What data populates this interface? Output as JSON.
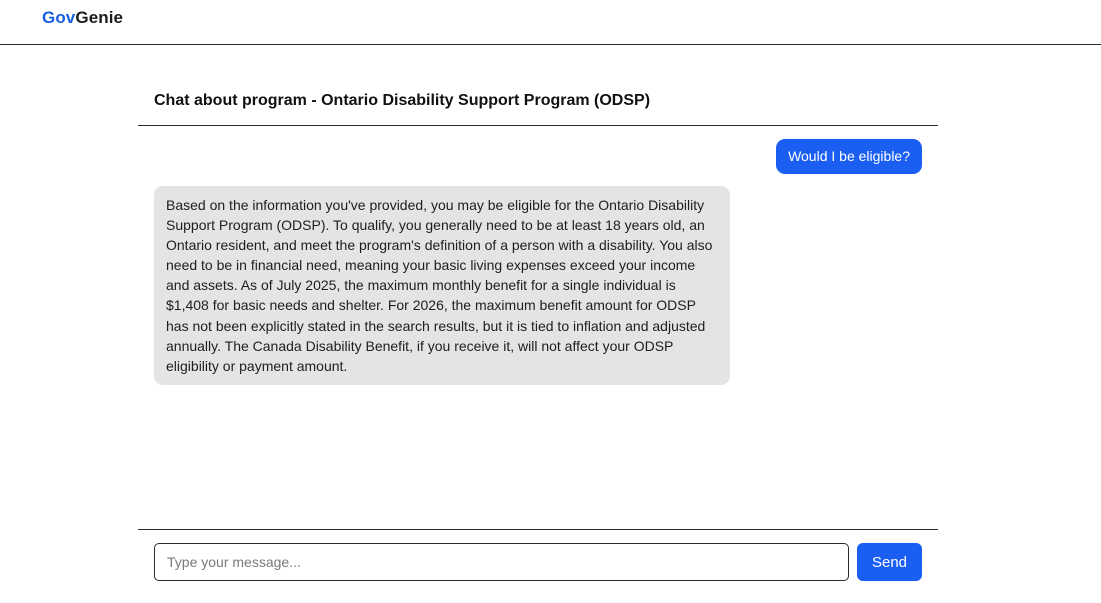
{
  "header": {
    "logo_part1": "Gov",
    "logo_part2": "Genie",
    "brand_color": "#1a5fe0"
  },
  "chat": {
    "title": "Chat about program - Ontario Disability Support Program (ODSP)",
    "messages": [
      {
        "role": "user",
        "text": "Would I be eligible?"
      },
      {
        "role": "assistant",
        "text": "Based on the information you've provided, you may be eligible for the Ontario Disability Support Program (ODSP). To qualify, you generally need to be at least 18 years old, an Ontario resident, and meet the program's definition of a person with a disability. You also need to be in financial need, meaning your basic living expenses exceed your income and assets. As of July 2025, the maximum monthly benefit for a single individual is $1,408 for basic needs and shelter. For 2026, the maximum benefit amount for ODSP has not been explicitly stated in the search results, but it is tied to inflation and adjusted annually. The Canada Disability Benefit, if you receive it, will not affect your ODSP eligibility or payment amount."
      }
    ],
    "user_bubble_color": "#1a5ff2",
    "assistant_bubble_color": "#e4e4e4"
  },
  "composer": {
    "input_value": "",
    "placeholder": "Type your message...",
    "send_label": "Send"
  }
}
